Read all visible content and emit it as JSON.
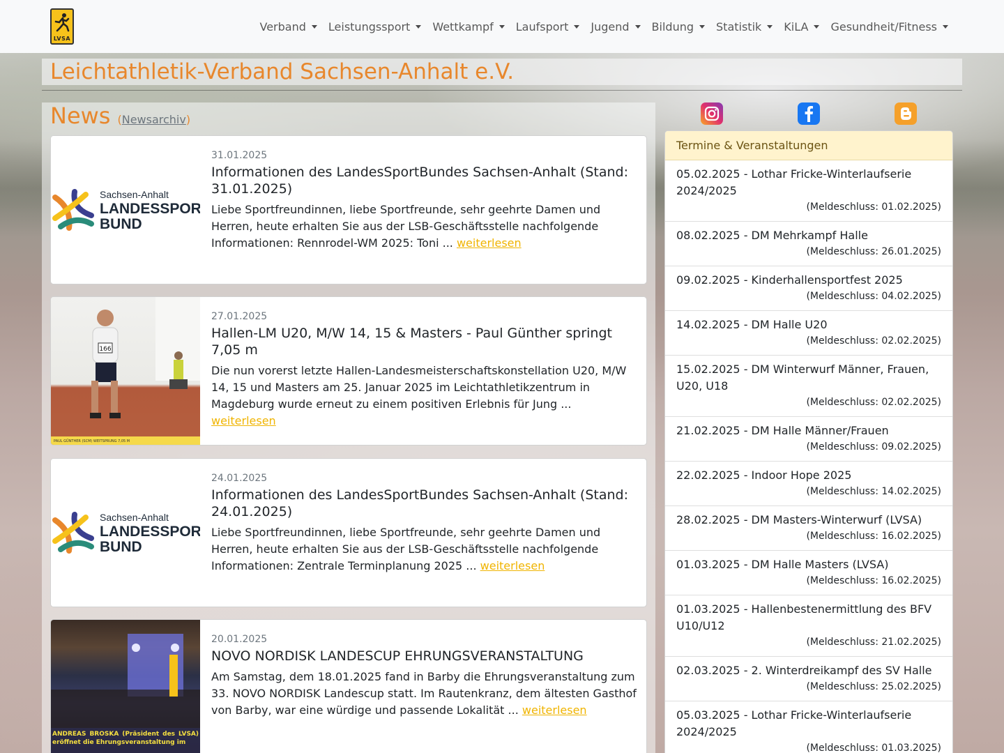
{
  "brand": {
    "logo_text": "LVSA"
  },
  "nav": {
    "items": [
      {
        "label": "Verband"
      },
      {
        "label": "Leistungssport"
      },
      {
        "label": "Wettkampf"
      },
      {
        "label": "Laufsport"
      },
      {
        "label": "Jugend"
      },
      {
        "label": "Bildung"
      },
      {
        "label": "Statistik"
      },
      {
        "label": "KiLA"
      },
      {
        "label": "Gesundheit/Fitness"
      }
    ]
  },
  "site_title": "Leichtathletik-Verband Sachsen-Anhalt e.V.",
  "news": {
    "heading": "News",
    "archive_link": "Newsarchiv",
    "read_more": "weiterlesen",
    "cards": [
      {
        "date": "31.01.2025",
        "title": "Informationen des LandesSportBundes Sachsen-Anhalt (Stand: 31.01.2025)",
        "text": "Liebe Sportfreundinnen, liebe Sportfreunde, sehr geehrte Damen und Herren, heute erhalten Sie aus der LSB-Geschäftsstelle nachfolgende Informationen: Rennrodel-WM 2025: Toni ...",
        "logo_sub": "Sachsen-Anhalt",
        "logo_line1": "LANDESSPORT",
        "logo_line2": "BUND"
      },
      {
        "date": "27.01.2025",
        "title": "Hallen-LM U20, M/W 14, 15 & Masters - Paul Günther springt 7,05 m",
        "text": "Die nun vorerst letzte Hallen-Landesmeisterschaftskonstellation U20, M/W 14, 15 und Masters am 25. Januar 2025 im Leichtathletikzentrum in Magdeburg wurde erneut zu einem positiven Erlebnis für Jung ...",
        "bib": "166",
        "caption": "PAUL GÜNTHER (SCM) WEITSPRUNG 7,05 M"
      },
      {
        "date": "24.01.2025",
        "title": "Informationen des LandesSportBundes Sachsen-Anhalt (Stand: 24.01.2025)",
        "text": "Liebe Sportfreundinnen, liebe Sportfreunde, sehr geehrte Damen und Herren, heute erhalten Sie aus der LSB-Geschäftsstelle nachfolgende Informationen: Zentrale Terminplanung 2025 ...",
        "logo_sub": "Sachsen-Anhalt",
        "logo_line1": "LANDESSPORT",
        "logo_line2": "BUND"
      },
      {
        "date": "20.01.2025",
        "title": "NOVO NORDISK LANDESCUP EHRUNGSVERANSTALTUNG",
        "text": "Am Samstag, dem 18.01.2025 fand in Barby die Ehrungsveranstaltung zum 33. NOVO NORDISK Landescup statt. Im Rautenkranz, dem ältesten Gasthof von Barby, war eine würdige und passende Lokalität ...",
        "caption": "ANDREAS BROSKA (Präsident des LVSA) eröffnet die Ehrungsveranstaltung im"
      }
    ]
  },
  "social": {
    "instagram": "instagram-icon",
    "facebook": "facebook-icon",
    "blogger": "blogger-icon"
  },
  "events": {
    "header": "Termine & Veranstaltungen",
    "items": [
      {
        "title": "05.02.2025 - Lothar Fricke-Winterlaufserie 2024/2025",
        "deadline": "(Meldeschluss: 01.02.2025)"
      },
      {
        "title": "08.02.2025 - DM Mehrkampf Halle",
        "deadline": "(Meldeschluss: 26.01.2025)"
      },
      {
        "title": "09.02.2025 - Kinderhallensportfest 2025",
        "deadline": "(Meldeschluss: 04.02.2025)"
      },
      {
        "title": "14.02.2025 - DM Halle U20",
        "deadline": "(Meldeschluss: 02.02.2025)"
      },
      {
        "title": "15.02.2025 - DM Winterwurf Männer, Frauen, U20, U18",
        "deadline": "(Meldeschluss: 02.02.2025)"
      },
      {
        "title": "21.02.2025 - DM Halle Männer/Frauen",
        "deadline": "(Meldeschluss: 09.02.2025)"
      },
      {
        "title": "22.02.2025 - Indoor Hope 2025",
        "deadline": "(Meldeschluss: 14.02.2025)"
      },
      {
        "title": "28.02.2025 - DM Masters-Winterwurf (LVSA)",
        "deadline": "(Meldeschluss: 16.02.2025)"
      },
      {
        "title": "01.03.2025 - DM Halle Masters (LVSA)",
        "deadline": "(Meldeschluss: 16.02.2025)"
      },
      {
        "title": "01.03.2025 - Hallenbestenermittlung des BFV U10/U12",
        "deadline": "(Meldeschluss: 21.02.2025)"
      },
      {
        "title": "02.03.2025 - 2. Winterdreikampf des SV Halle",
        "deadline": "(Meldeschluss: 25.02.2025)"
      },
      {
        "title": "05.03.2025 - Lothar Fricke-Winterlaufserie 2024/2025",
        "deadline": "(Meldeschluss: 01.03.2025)"
      }
    ]
  },
  "colors": {
    "accent": "#e8872c",
    "link_more": "#f0b400",
    "events_header_bg": "#fff3cd"
  }
}
